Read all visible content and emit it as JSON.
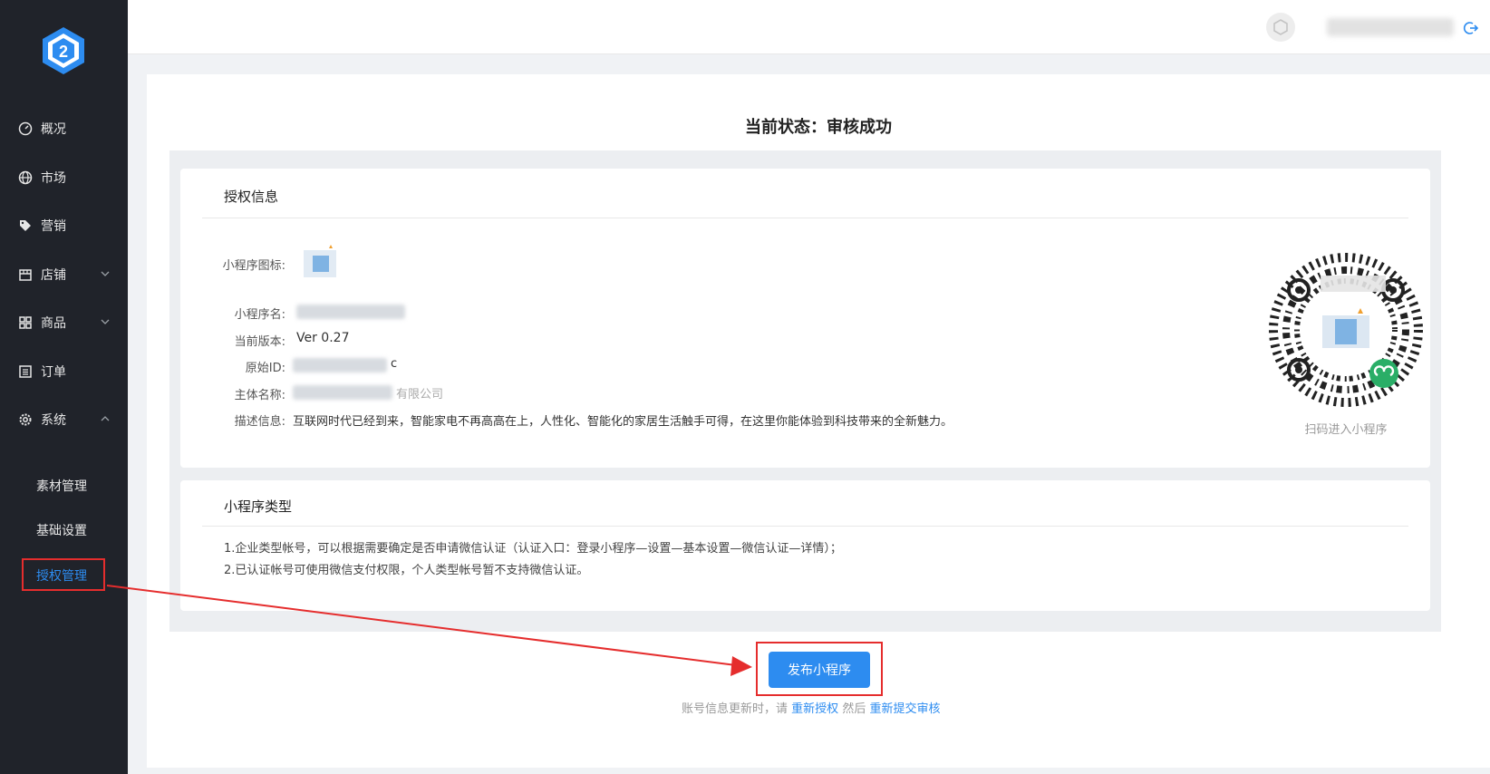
{
  "sidebar": {
    "items": [
      {
        "label": "概况",
        "icon": "dashboard-icon"
      },
      {
        "label": "市场",
        "icon": "globe-icon"
      },
      {
        "label": "营销",
        "icon": "tag-icon"
      },
      {
        "label": "店铺",
        "icon": "store-icon"
      },
      {
        "label": "商品",
        "icon": "grid-icon"
      },
      {
        "label": "订单",
        "icon": "list-icon"
      },
      {
        "label": "系统",
        "icon": "gear-icon"
      }
    ],
    "sub_items": [
      {
        "label": "素材管理"
      },
      {
        "label": "基础设置"
      },
      {
        "label": "授权管理",
        "active": true
      }
    ]
  },
  "main": {
    "status_title": "当前状态：审核成功",
    "auth_info": {
      "title": "授权信息",
      "labels": {
        "icon": "小程序图标:",
        "name": "小程序名:",
        "version": "当前版本:",
        "original_id": "原始ID:",
        "subject": "主体名称:",
        "description": "描述信息:"
      },
      "version_value": "Ver 0.27",
      "original_id_suffix": "c",
      "subject_suffix": "有限公司",
      "description_value": "互联网时代已经到来，智能家电不再高高在上，人性化、智能化的家居生活触手可得，在这里你能体验到科技带来的全新魅力。",
      "qr_caption": "扫码进入小程序"
    },
    "type_info": {
      "title": "小程序类型",
      "lines": [
        "1.企业类型帐号，可以根据需要确定是否申请微信认证（认证入口：登录小程序—设置—基本设置—微信认证—详情）；",
        "2.已认证帐号可使用微信支付权限，个人类型帐号暂不支持微信认证。"
      ]
    },
    "publish_button": "发布小程序",
    "hint": {
      "prefix": "账号信息更新时，请",
      "reauth_link": "重新授权",
      "middle": "然后",
      "resubmit_link": "重新提交审核"
    }
  },
  "colors": {
    "sidebar_bg": "#20232a",
    "accent": "#2d8cf0",
    "highlight_red": "#e52d2d"
  }
}
